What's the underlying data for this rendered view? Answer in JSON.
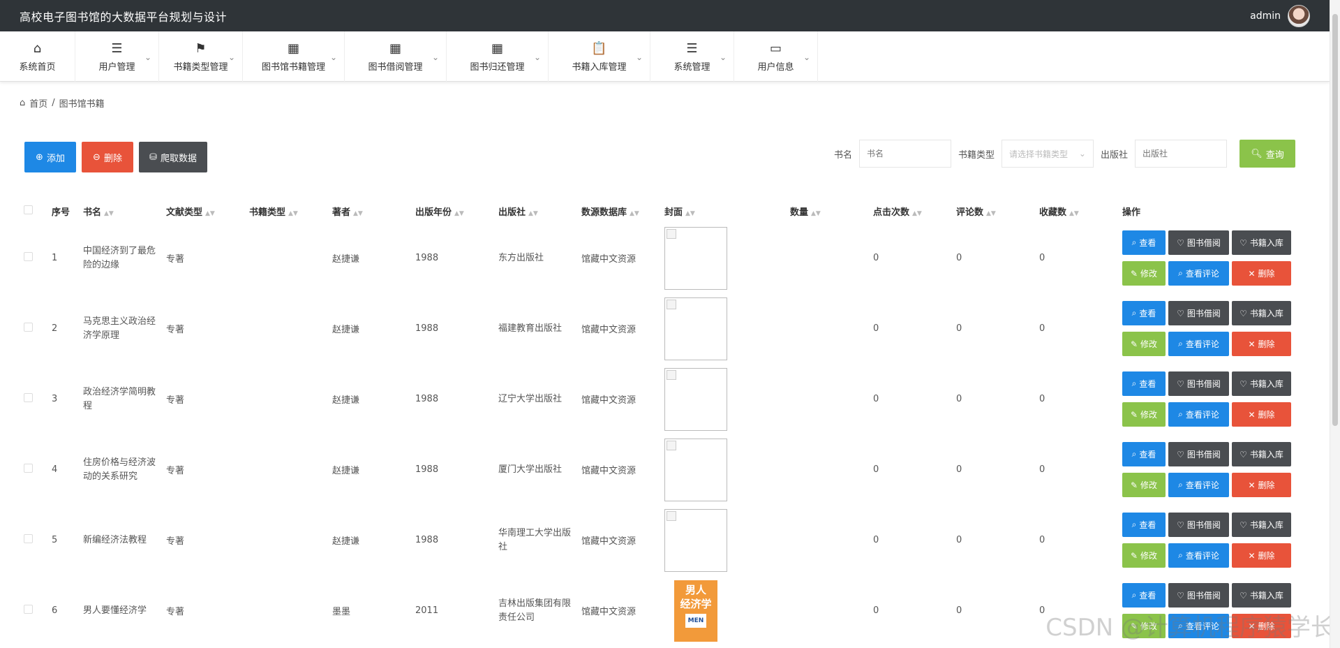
{
  "header": {
    "title": "高校电子图书馆的大数据平台规划与设计",
    "username": "admin"
  },
  "nav": [
    {
      "label": "系统首页",
      "icon": "home-icon",
      "glyph": "⌂"
    },
    {
      "label": "用户管理",
      "icon": "list-icon",
      "glyph": "☰"
    },
    {
      "label": "书籍类型管理",
      "icon": "flag-icon",
      "glyph": "⚑"
    },
    {
      "label": "图书馆书籍管理",
      "icon": "grid-icon",
      "glyph": "▦"
    },
    {
      "label": "图书借阅管理",
      "icon": "grid-icon",
      "glyph": "▦"
    },
    {
      "label": "图书归还管理",
      "icon": "grid-icon",
      "glyph": "▦"
    },
    {
      "label": "书籍入库管理",
      "icon": "clipboard-icon",
      "glyph": "📋"
    },
    {
      "label": "系统管理",
      "icon": "list-icon",
      "glyph": "☰"
    },
    {
      "label": "用户信息",
      "icon": "card-icon",
      "glyph": "▭"
    }
  ],
  "breadcrumb": {
    "home": "首页",
    "sep": "/",
    "current": "图书馆书籍"
  },
  "toolbar": {
    "add": "添加",
    "delete": "删除",
    "crawl": "爬取数据"
  },
  "search": {
    "name_label": "书名",
    "name_placeholder": "书名",
    "type_label": "书籍类型",
    "type_placeholder": "请选择书籍类型",
    "publisher_label": "出版社",
    "publisher_placeholder": "出版社",
    "query": "查询"
  },
  "table": {
    "headers": [
      "序号",
      "书名",
      "文献类型",
      "书籍类型",
      "著者",
      "出版年份",
      "出版社",
      "数源数据库",
      "封面",
      "数量",
      "点击次数",
      "评论数",
      "收藏数",
      "操作"
    ],
    "rows": [
      {
        "no": "1",
        "name": "中国经济到了最危险的边缘",
        "doc_type": "专著",
        "book_type": "",
        "author": "赵捷谦",
        "year": "1988",
        "publisher": "东方出版社",
        "db": "馆藏中文资源",
        "count": "",
        "clicks": "0",
        "comments": "0",
        "favs": "0"
      },
      {
        "no": "2",
        "name": "马克思主义政治经济学原理",
        "doc_type": "专著",
        "book_type": "",
        "author": "赵捷谦",
        "year": "1988",
        "publisher": "福建教育出版社",
        "db": "馆藏中文资源",
        "count": "",
        "clicks": "0",
        "comments": "0",
        "favs": "0"
      },
      {
        "no": "3",
        "name": "政治经济学简明教程",
        "doc_type": "专著",
        "book_type": "",
        "author": "赵捷谦",
        "year": "1988",
        "publisher": "辽宁大学出版社",
        "db": "馆藏中文资源",
        "count": "",
        "clicks": "0",
        "comments": "0",
        "favs": "0"
      },
      {
        "no": "4",
        "name": "住房价格与经济波动的关系研究",
        "doc_type": "专著",
        "book_type": "",
        "author": "赵捷谦",
        "year": "1988",
        "publisher": "厦门大学出版社",
        "db": "馆藏中文资源",
        "count": "",
        "clicks": "0",
        "comments": "0",
        "favs": "0"
      },
      {
        "no": "5",
        "name": "新编经济法教程",
        "doc_type": "专著",
        "book_type": "",
        "author": "赵捷谦",
        "year": "1988",
        "publisher": "华南理工大学出版社",
        "db": "馆藏中文资源",
        "count": "",
        "clicks": "0",
        "comments": "0",
        "favs": "0"
      },
      {
        "no": "6",
        "name": "男人要懂经济学",
        "doc_type": "专著",
        "book_type": "",
        "author": "墨墨",
        "year": "2011",
        "publisher": "吉林出版集团有限责任公司",
        "db": "馆藏中文资源",
        "count": "",
        "clicks": "0",
        "comments": "0",
        "favs": "0"
      }
    ],
    "ops": {
      "view": "查看",
      "borrow": "图书借阅",
      "stock": "书籍入库",
      "edit": "修改",
      "view_comments": "查看评论",
      "delete": "删除"
    }
  },
  "cover6": {
    "line1": "男人",
    "line2": "经济学",
    "sub": "MEN"
  },
  "watermark": "CSDN @计算机程序猿学长"
}
